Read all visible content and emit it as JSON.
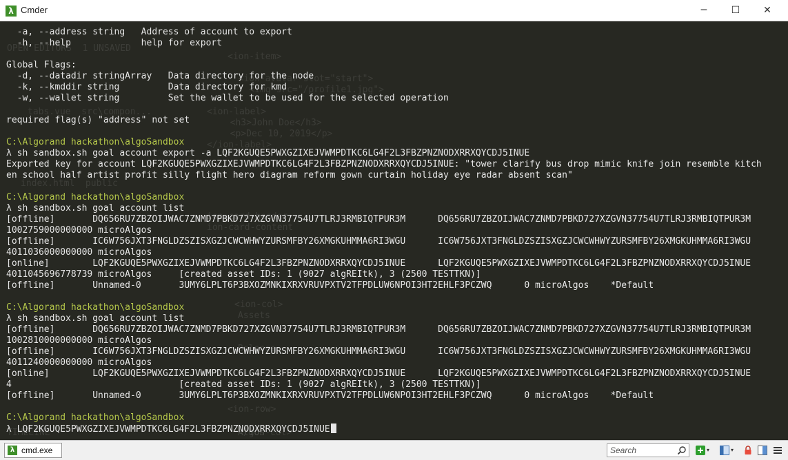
{
  "window": {
    "title": "Cmder",
    "app_icon_glyph": "λ",
    "minimize_glyph": "─",
    "maximize_glyph": "☐",
    "close_glyph": "✕"
  },
  "colors": {
    "terminal_bg": "#272822",
    "text": "#e6e6e6",
    "prompt_path": "#b5c74a"
  },
  "terminal": {
    "lines": [
      {
        "text": "  -a, --address string   Address of account to export"
      },
      {
        "text": "  -h, --help             help for export"
      },
      {
        "text": ""
      },
      {
        "text": "Global Flags:"
      },
      {
        "text": "  -d, --datadir stringArray   Data directory for the node"
      },
      {
        "text": "  -k, --kmddir string         Data directory for kmd"
      },
      {
        "text": "  -w, --wallet string         Set the wallet to be used for the selected operation"
      },
      {
        "text": ""
      },
      {
        "text": "required flag(s) \"address\" not set"
      },
      {
        "text": ""
      },
      {
        "text": "C:\\Algorand hackathon\\algoSandbox",
        "kind": "path"
      },
      {
        "text": "λ sh sandbox.sh goal account export -a LQF2KGUQE5PWXGZIXEJVWMPDTKC6LG4F2L3FBZPNZNODXRRXQYCDJ5INUE"
      },
      {
        "text": "Exported key for account LQF2KGUQE5PWXGZIXEJVWMPDTKC6LG4F2L3FBZPNZNODXRRXQYCDJ5INUE: \"tower clarify bus drop mimic knife join resemble kitch"
      },
      {
        "text": "en school half artist profit silly flight hero diagram reform gown curtain holiday eye radar absent scan\""
      },
      {
        "text": ""
      },
      {
        "text": "C:\\Algorand hackathon\\algoSandbox",
        "kind": "path"
      },
      {
        "text": "λ sh sandbox.sh goal account list"
      },
      {
        "text": "[offline]       DQ656RU7ZBZOIJWAC7ZNMD7PBKD727XZGVN37754U7TLRJ3RMBIQTPUR3M      DQ656RU7ZBZOIJWAC7ZNMD7PBKD727XZGVN37754U7TLRJ3RMBIQTPUR3M"
      },
      {
        "text": "1002759000000000 microAlgos"
      },
      {
        "text": "[offline]       IC6W756JXT3FNGLDZSZISXGZJCWCWHWYZURSMFBY26XMGKUHMMA6RI3WGU      IC6W756JXT3FNGLDZSZISXGZJCWCWHWYZURSMFBY26XMGKUHMMA6RI3WGU"
      },
      {
        "text": "4011036000000000 microAlgos"
      },
      {
        "text": "[online]        LQF2KGUQE5PWXGZIXEJVWMPDTKC6LG4F2L3FBZPNZNODXRRXQYCDJ5INUE      LQF2KGUQE5PWXGZIXEJVWMPDTKC6LG4F2L3FBZPNZNODXRRXQYCDJ5INUE"
      },
      {
        "text": "4011045696778739 microAlgos     [created asset IDs: 1 (9027 algREItk), 3 (2500 TESTTKN)]"
      },
      {
        "text": "[offline]       Unnamed-0       3UMY6LPLT6P3BXOZMNKIXRXVRUVPXTV2TFPDLUW6NPOI3HT2EHLF3PCZWQ      0 microAlgos    *Default"
      },
      {
        "text": ""
      },
      {
        "text": "C:\\Algorand hackathon\\algoSandbox",
        "kind": "path"
      },
      {
        "text": "λ sh sandbox.sh goal account list"
      },
      {
        "text": "[offline]       DQ656RU7ZBZOIJWAC7ZNMD7PBKD727XZGVN37754U7TLRJ3RMBIQTPUR3M      DQ656RU7ZBZOIJWAC7ZNMD7PBKD727XZGVN37754U7TLRJ3RMBIQTPUR3M"
      },
      {
        "text": "1002810000000000 microAlgos"
      },
      {
        "text": "[offline]       IC6W756JXT3FNGLDZSZISXGZJCWCWHWYZURSMFBY26XMGKUHMMA6RI3WGU      IC6W756JXT3FNGLDZSZISXGZJCWCWHWYZURSMFBY26XMGKUHMMA6RI3WGU"
      },
      {
        "text": "4011240000000000 microAlgos"
      },
      {
        "text": "[online]        LQF2KGUQE5PWXGZIXEJVWMPDTKC6LG4F2L3FBZPNZNODXRRXQYCDJ5INUE      LQF2KGUQE5PWXGZIXEJVWMPDTKC6LG4F2L3FBZPNZNODXRRXQYCDJ5INUE"
      },
      {
        "text": "4                               [created asset IDs: 1 (9027 algREItk), 3 (2500 TESTTKN)]"
      },
      {
        "text": "[offline]       Unnamed-0       3UMY6LPLT6P3BXOZMNKIXRXVRUVPXTV2TFPDLUW6NPOI3HT2EHLF3PCZWQ      0 microAlgos    *Default"
      },
      {
        "text": ""
      },
      {
        "text": "C:\\Algorand hackathon\\algoSandbox",
        "kind": "path"
      },
      {
        "text": "λ LQF2KGUQE5PWXGZIXEJVWMPDTKC6LG4F2L3FBZPNZNODXRRXQYCDJ5INUE",
        "cursor": true
      }
    ],
    "ghost_lines": [
      "OPEN EDITORS  1 UNSAVED",
      "tabs.vue  src\\compon...",
      "<ion-item>",
      "  <ion-avatar slot=\"start\">",
      "    <img src=\"/profile1.jpg\">",
      "<ion-label>",
      "  <h3>John Doe</h3>",
      "  <p>Dec 10, 2019</p>",
      "</ion-label>",
      "index.html  public",
      "ion-card-header",
      "ion-card-content",
      "<ion-col>",
      "Assets",
      "Balance",
      "<ion-row>",
      "Algos",
      "</ion-col>",
      "TIMELINE"
    ]
  },
  "statusbar": {
    "tab_icon_glyph": "λ",
    "tab_label": "cmd.exe",
    "search_placeholder": "Search",
    "caret_glyph": "▾"
  },
  "icons": {
    "search": "search-icon",
    "new_console": "plus-icon",
    "switch_view": "window-icon",
    "lock": "lock-icon",
    "split": "split-view-icon",
    "settings": "hamburger-menu-icon"
  }
}
